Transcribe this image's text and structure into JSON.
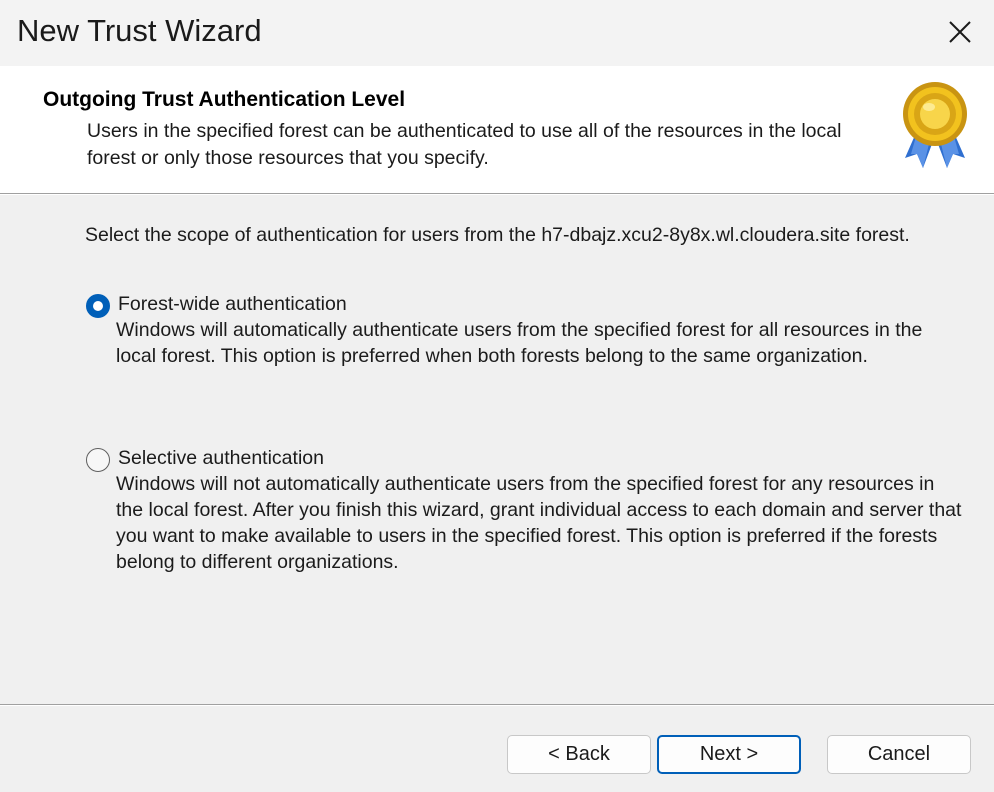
{
  "window": {
    "title": "New Trust Wizard",
    "close_icon": "close-icon"
  },
  "header": {
    "title": "Outgoing Trust Authentication Level",
    "description": "Users in the specified forest can be authenticated to use all of the resources in the local forest or only those resources that you specify.",
    "badge_icon": "award-ribbon-icon"
  },
  "content": {
    "prompt": "Select the scope of authentication for users from the h7-dbajz.xcu2-8y8x.wl.cloudera.site forest.",
    "options": [
      {
        "label": "Forest-wide authentication",
        "description": "Windows will automatically authenticate users from the specified forest for all resources in the local forest. This option is preferred when both forests belong to the same organization.",
        "checked": true
      },
      {
        "label": "Selective authentication",
        "description": "Windows will not automatically authenticate users from the specified forest for any resources in the local forest. After you finish this wizard, grant individual access to each domain and server that you want to make available to users in the specified forest. This option is preferred if the forests belong to different organizations.",
        "checked": false
      }
    ]
  },
  "buttons": {
    "back": "< Back",
    "next": "Next >",
    "cancel": "Cancel"
  },
  "colors": {
    "accent": "#005fb8",
    "window_bg": "#f0f0f0",
    "header_bg": "#ffffff"
  }
}
